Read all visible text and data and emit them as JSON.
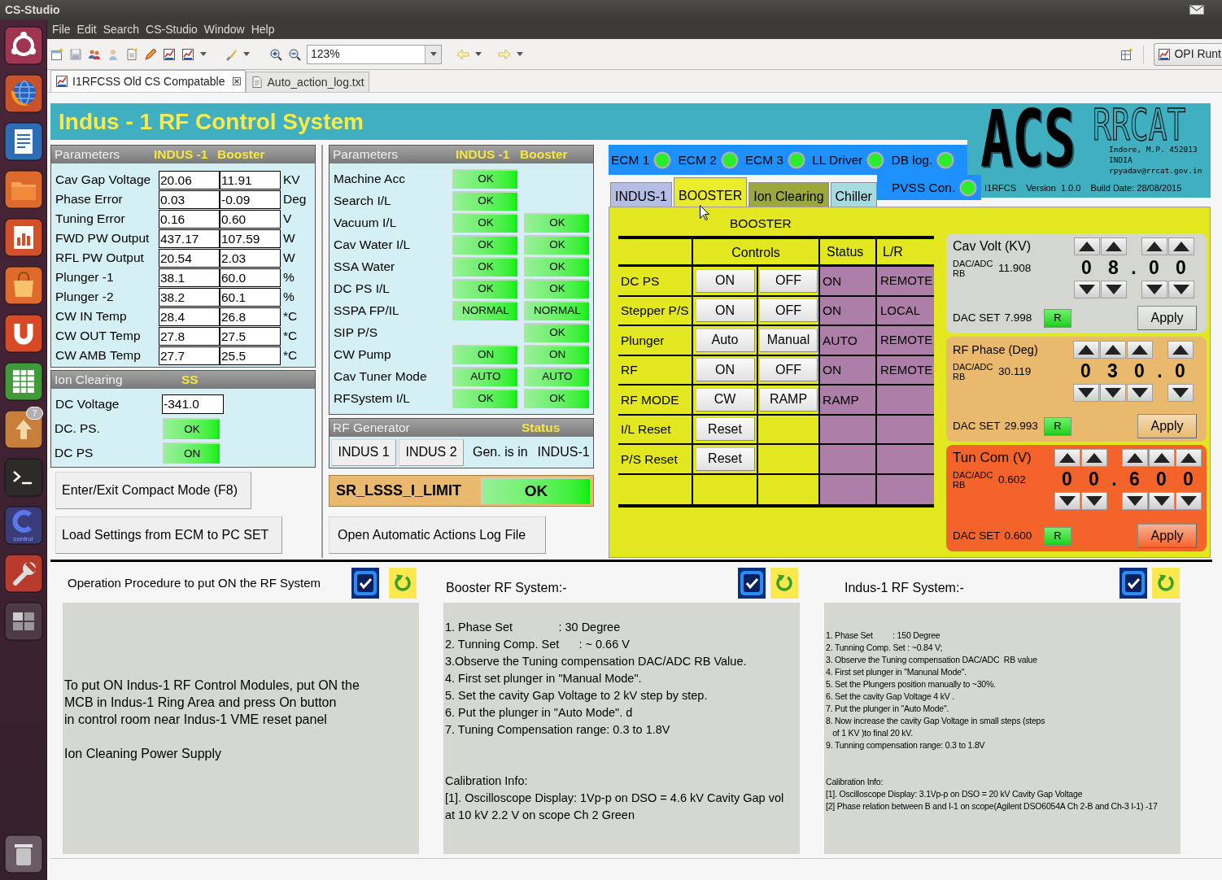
{
  "window": {
    "title": "CS-Studio"
  },
  "launcher": [
    {
      "kind": "home"
    },
    {
      "kind": "browser"
    },
    {
      "kind": "writer"
    },
    {
      "kind": "files"
    },
    {
      "kind": "impress"
    },
    {
      "kind": "store"
    },
    {
      "kind": "cloud"
    },
    {
      "kind": "calc"
    },
    {
      "kind": "updates",
      "badge": "7"
    },
    {
      "kind": "terminal"
    },
    {
      "kind": "control",
      "label": "control"
    },
    {
      "kind": "settings"
    },
    {
      "kind": "workspaces"
    },
    {
      "kind": "trash"
    }
  ],
  "menu": [
    "File",
    "Edit",
    "Search",
    "CS-Studio",
    "Window",
    "Help"
  ],
  "toolbar": {
    "zoom": "123%",
    "perspective": "OPI Runt"
  },
  "editor_tabs": [
    {
      "label": "I1RFCSS Old CS Compatable",
      "kind": "display",
      "selected": true
    },
    {
      "label": "Auto_action_log.txt",
      "kind": "text",
      "selected": false
    }
  ],
  "display": {
    "title": "Indus - 1 RF Control System",
    "logo": {
      "mark": "ACS",
      "org": "RRCAT",
      "address": [
        "Indore, M.P. 452013",
        "INDIA",
        "rpyadav@rrcat.gov.in"
      ],
      "app": "I1RFCS",
      "version": "Version  1.0.0",
      "build": "Build Date: 28/08/2015"
    },
    "parameters": {
      "header": {
        "title": "Parameters",
        "col_1": "INDUS -1",
        "col_2": "Booster"
      },
      "rows": [
        {
          "label": "Cav Gap Voltage",
          "indus": "20.06",
          "booster": "11.91",
          "unit": "KV"
        },
        {
          "label": "Phase Error",
          "indus": "0.03",
          "booster": "-0.09",
          "unit": "Deg"
        },
        {
          "label": "Tuning Error",
          "indus": "0.16",
          "booster": "0.60",
          "unit": "V"
        },
        {
          "label": "FWD PW Output",
          "indus": "437.17",
          "booster": "107.59",
          "unit": "W"
        },
        {
          "label": "RFL PW Output",
          "indus": "20.54",
          "booster": "2.03",
          "unit": "W"
        },
        {
          "label": "Plunger -1",
          "indus": "38.1",
          "booster": "60.0",
          "unit": "%"
        },
        {
          "label": "Plunger -2",
          "indus": "38.2",
          "booster": "60.1",
          "unit": "%"
        },
        {
          "label": "CW IN Temp",
          "indus": "28.4",
          "booster": "26.8",
          "unit": "*C"
        },
        {
          "label": "CW OUT Temp",
          "indus": "27.8",
          "booster": "27.5",
          "unit": "*C"
        },
        {
          "label": "CW AMB Temp",
          "indus": "27.7",
          "booster": "25.5",
          "unit": "*C"
        }
      ]
    },
    "ion_clearing": {
      "header": {
        "title": "Ion Clearing",
        "col_1": "SS"
      },
      "voltage": {
        "label": "DC Voltage",
        "value": "-341.0"
      },
      "indicators": [
        {
          "label": "DC. PS.",
          "value": "OK"
        },
        {
          "label": "DC PS",
          "value": "ON"
        }
      ]
    },
    "actions": [
      "Enter/Exit Compact Mode (F8)",
      "Load Settings from ECM to PC SET"
    ],
    "interlocks": {
      "header": {
        "title": "Parameters",
        "col_1": "INDUS -1",
        "col_2": "Booster"
      },
      "rows": [
        {
          "label": "Machine Acc",
          "indus": "OK"
        },
        {
          "label": "Search I/L",
          "indus": "OK"
        },
        {
          "label": "Vacuum I/L",
          "indus": "OK",
          "booster": "OK"
        },
        {
          "label": "Cav Water I/L",
          "indus": "OK",
          "booster": "OK"
        },
        {
          "label": "SSA Water",
          "indus": "OK",
          "booster": "OK"
        },
        {
          "label": "DC PS I/L",
          "indus": "OK",
          "booster": "OK"
        },
        {
          "label": "SSPA FP/IL",
          "indus": "NORMAL",
          "booster": "NORMAL"
        },
        {
          "label": "SIP P/S",
          "booster": "OK"
        },
        {
          "label": "CW Pump",
          "indus": "ON",
          "booster": "ON"
        },
        {
          "label": "Cav Tuner Mode",
          "indus": "AUTO",
          "booster": "AUTO"
        },
        {
          "label": "RFSystem I/L",
          "indus": "OK",
          "booster": "OK"
        }
      ]
    },
    "rf_generator": {
      "header": {
        "title": "RF Generator",
        "col_1": "Status"
      },
      "buttons": [
        "INDUS 1",
        "INDUS 2"
      ],
      "status_label": "Gen. is in",
      "status_value": "INDUS-1"
    },
    "limit": {
      "label": "SR_LSSS_I_LIMIT",
      "value": "OK"
    },
    "log_button": "Open Automatic Actions Log File",
    "status_leds": [
      {
        "label": "ECM 1",
        "on": true
      },
      {
        "label": "ECM 2",
        "on": true
      },
      {
        "label": "ECM 3",
        "on": true
      },
      {
        "label": "LL Driver",
        "on": true
      },
      {
        "label": "DB log.",
        "on": true
      },
      {
        "label": "PVSS Con.",
        "on": true
      }
    ],
    "mode_tabs": [
      {
        "label": "INDUS-1",
        "selected": false,
        "color": "#b4bde3"
      },
      {
        "label": "BOOSTER",
        "selected": true,
        "color": "#e8ec2a"
      },
      {
        "label": "Ion Clearing",
        "selected": false,
        "color": "#9aa83e"
      },
      {
        "label": "Chiller",
        "selected": false,
        "color": "#a6dbe2"
      }
    ],
    "booster": {
      "title": "BOOSTER",
      "columns": [
        "Controls",
        "Status",
        "L/R"
      ],
      "rows": [
        {
          "label": "DC PS",
          "controls": [
            "ON",
            "OFF"
          ],
          "status": "ON",
          "mode": "REMOTE"
        },
        {
          "label": "Stepper P/S",
          "controls": [
            "ON",
            "OFF"
          ],
          "status": "ON",
          "mode": "LOCAL"
        },
        {
          "label": "Plunger",
          "controls": [
            "Auto",
            "Manual"
          ],
          "status": "AUTO",
          "mode": "REMOTE"
        },
        {
          "label": "RF",
          "controls": [
            "ON",
            "OFF"
          ],
          "status": "ON",
          "mode": "REMOTE"
        },
        {
          "label": "RF MODE",
          "controls": [
            "CW",
            "RAMP"
          ],
          "status": "RAMP"
        },
        {
          "label": "I/L Reset",
          "controls": [
            "Reset"
          ]
        },
        {
          "label": "P/S Reset",
          "controls": [
            "Reset"
          ]
        }
      ]
    },
    "setpoints": [
      {
        "title": "Cav Volt (KV)",
        "color": "#d3d7cf",
        "rb_label": "DAC/ADC RB",
        "rb_value": "11.908",
        "digits": [
          {
            "kind": "digit",
            "char": "0"
          },
          {
            "kind": "digit",
            "char": "8"
          },
          {
            "kind": "point",
            "char": "."
          },
          {
            "kind": "digit",
            "char": "0"
          },
          {
            "kind": "digit",
            "char": "0"
          }
        ],
        "dac_label": "DAC SET",
        "dac_value": "7.998",
        "readback": "R",
        "apply": "Apply"
      },
      {
        "title": "RF Phase (Deg)",
        "color": "#e9b96e",
        "rb_label": "DAC/ADC RB",
        "rb_value": "30.119",
        "digits": [
          {
            "kind": "digit",
            "char": "0"
          },
          {
            "kind": "digit",
            "char": "3"
          },
          {
            "kind": "digit",
            "char": "0"
          },
          {
            "kind": "point",
            "char": "."
          },
          {
            "kind": "digit",
            "char": "0"
          }
        ],
        "dac_label": "DAC SET",
        "dac_value": "29.993",
        "readback": "R",
        "apply": "Apply"
      },
      {
        "title": "Tun Com (V)",
        "color": "#f4642a",
        "rb_label": "DAC/ADC RB",
        "rb_value": "0.602",
        "digits": [
          {
            "kind": "digit",
            "char": "0"
          },
          {
            "kind": "digit",
            "char": "0"
          },
          {
            "kind": "point",
            "char": "."
          },
          {
            "kind": "digit",
            "char": "6"
          },
          {
            "kind": "digit",
            "char": "0"
          },
          {
            "kind": "digit",
            "char": "0"
          }
        ],
        "dac_label": "DAC SET",
        "dac_value": "0.600",
        "readback": "R",
        "apply": "Apply"
      }
    ],
    "notes": [
      {
        "title": "Operation Procedure to put ON the RF System",
        "paragraphs": [
          "To put ON Indus-1 RF Control Modules, put ON the\nMCB in Indus-1 Ring Area and press On button\nin control room near Indus-1 VME reset panel",
          "Ion Cleaning Power Supply"
        ]
      },
      {
        "title": "Booster RF System:-",
        "paragraphs": [
          "1. Phase Set              : 30 Degree\n2. Tunning Comp. Set      : ~ 0.66 V\n3.Observe the Tuning compensation DAC/ADC RB Value.\n4. First set plunger in \"Manual Mode\".\n5. Set the cavity Gap Voltage to 2 kV step by step.\n6. Put the plunger in \"Auto Mode\". d\n7. Tuning Compensation range: 0.3 to 1.8V",
          "Calibration Info:\n[1]. Oscilloscope Display: 1Vp-p on DSO = 4.6 kV Cavity Gap vol\nat 10 kV 2.2 V on scope Ch 2 Green"
        ]
      },
      {
        "title": "Indus-1 RF System:-",
        "paragraphs": [
          "1. Phase Set         : 150 Degree\n2. Tunning Comp. Set : ~0.84 V;\n3. Observe the Tuning compensation DAC/ADC  RB value\n4. First set plunger in \"Manunal Mode\".\n5. Set the Plungers position manually to ~30%.\n6. Set the cavity Gap Voltage 4 kV .\n7. Put the plunger in \"Auto Mode\".\n8. Now increase the cavity Gap Voltage in small steps (steps\n   of 1 KV )to final 20 kV.\n9. Tunning compensation range: 0.3 to 1.8V",
          "Calibration Info:\n[1]. Oscilloscope Display: 3.1Vp-p on DSO = 20 kV Cavity Gap Voltage\n[2] Phase relation between B and I-1 on scope(Agilent DSO6054A Ch 2-B and Ch-3 I-1) -17"
        ]
      }
    ]
  }
}
